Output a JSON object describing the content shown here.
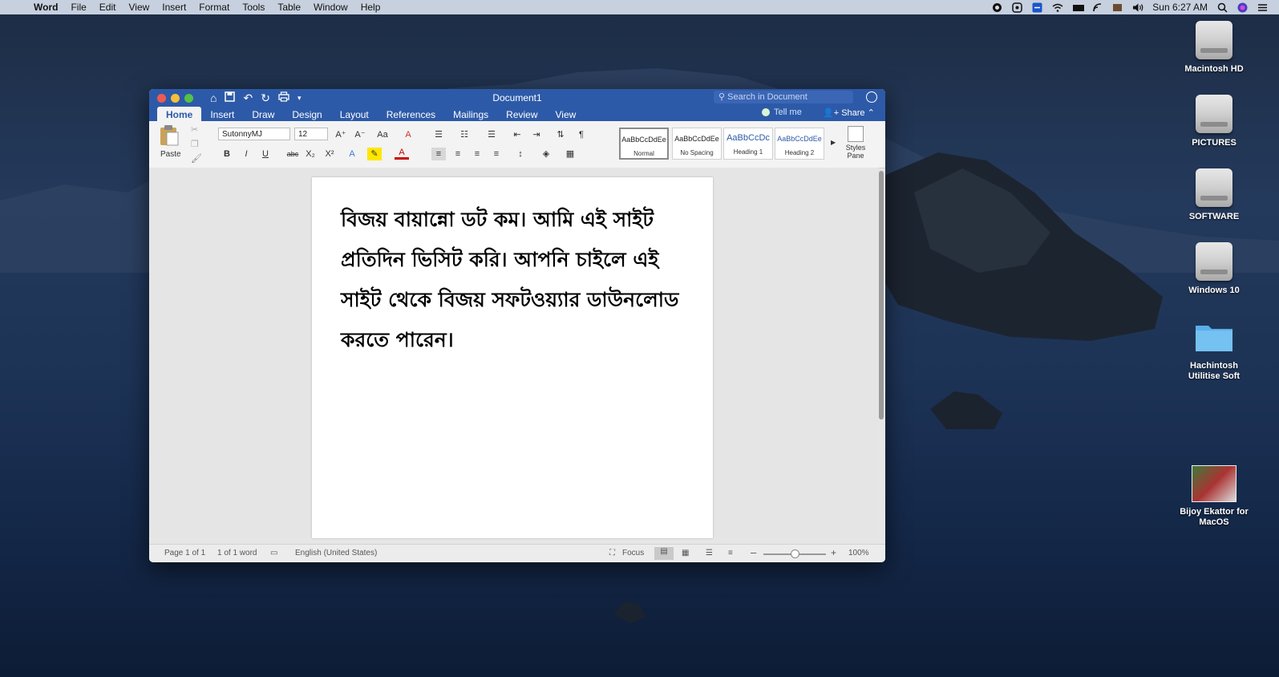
{
  "menubar": {
    "app": "Word",
    "items": [
      "File",
      "Edit",
      "View",
      "Insert",
      "Format",
      "Tools",
      "Table",
      "Window",
      "Help"
    ],
    "clock": "Sun 6:27 AM"
  },
  "desktop": {
    "icons": [
      {
        "label": "Macintosh HD",
        "kind": "drive"
      },
      {
        "label": "PICTURES",
        "kind": "drive"
      },
      {
        "label": "SOFTWARE",
        "kind": "drive"
      },
      {
        "label": "Windows 10",
        "kind": "drive"
      },
      {
        "label": "Hachintosh Utilitise Soft",
        "kind": "folder"
      },
      {
        "label": "Bijoy Ekattor for MacOS",
        "kind": "app"
      }
    ]
  },
  "window": {
    "title": "Document1",
    "search_placeholder": "Search in Document",
    "tabs": [
      "Home",
      "Insert",
      "Draw",
      "Design",
      "Layout",
      "References",
      "Mailings",
      "Review",
      "View"
    ],
    "active_tab": "Home",
    "tell_me": "Tell me",
    "share": "Share"
  },
  "ribbon": {
    "paste_label": "Paste",
    "font_name": "SutonnyMJ",
    "font_size": "12",
    "bold": "B",
    "italic": "I",
    "underline": "U",
    "strike": "abc",
    "styles": [
      {
        "preview": "AaBbCcDdEe",
        "name": "Normal",
        "selected": true
      },
      {
        "preview": "AaBbCcDdEe",
        "name": "No Spacing",
        "selected": false
      },
      {
        "preview": "AaBbCcDc",
        "name": "Heading 1",
        "selected": false
      },
      {
        "preview": "AaBbCcDdEe",
        "name": "Heading 2",
        "selected": false
      }
    ],
    "styles_pane_line1": "Styles",
    "styles_pane_line2": "Pane"
  },
  "document": {
    "text": "বিজয় বায়ান্নো ডট কম। আমি এই সাইট প্রতিদিন ভিসিট করি। আপনি চাইলে এই সাইট থেকে বিজয় সফটওয়্যার ডাউনলোড করতে পারেন।"
  },
  "status": {
    "page": "Page 1 of 1",
    "words": "1 of 1 word",
    "language": "English (United States)",
    "focus": "Focus",
    "zoom": "100%",
    "zoom_value": 100
  },
  "colors": {
    "titlebar": "#2d5aa8",
    "close": "#ee5a52",
    "minimize": "#f5be3c",
    "zoom": "#55c146"
  }
}
